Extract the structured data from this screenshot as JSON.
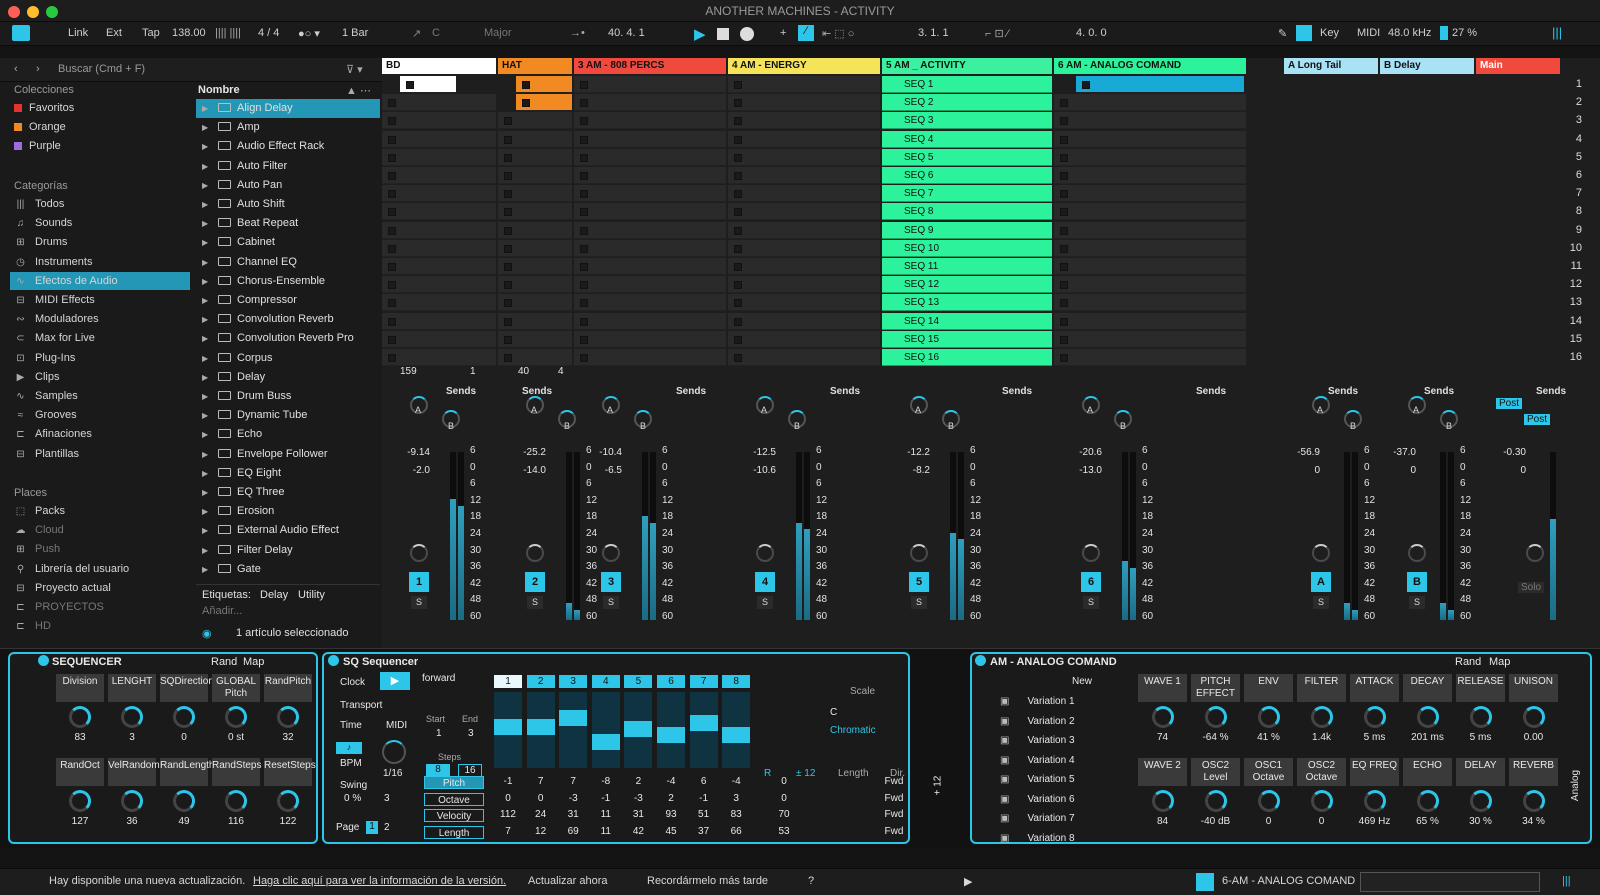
{
  "app": {
    "title": "ANOTHER MACHINES - ACTIVITY"
  },
  "control_bar": {
    "link": "Link",
    "ext": "Ext",
    "tap": "Tap",
    "tempo": "138.00",
    "signature": "4 / 4",
    "quantize": "1 Bar",
    "key": "C",
    "scale": "Major",
    "position": "40.  4.  1",
    "loop_start": "3.  1.  1",
    "loop_length": "4.  0.  0",
    "key_btn": "Key",
    "midi_btn": "MIDI",
    "sample_rate": "48.0 kHz",
    "cpu": "27 %"
  },
  "browser": {
    "search_placeholder": "Buscar (Cmd + F)",
    "col_header": "Nombre",
    "collections_title": "Colecciones",
    "collections": [
      {
        "label": "Favoritos",
        "color": "#e5332f"
      },
      {
        "label": "Orange",
        "color": "#f28a23"
      },
      {
        "label": "Purple",
        "color": "#9b6ddf"
      }
    ],
    "categories_title": "Categorías",
    "categories": [
      {
        "label": "Todos",
        "icon": "bars-icon"
      },
      {
        "label": "Sounds",
        "icon": "note-icon"
      },
      {
        "label": "Drums",
        "icon": "grid-icon"
      },
      {
        "label": "Instruments",
        "icon": "clock-icon"
      },
      {
        "label": "Efectos de Audio",
        "icon": "wave-icon"
      },
      {
        "label": "MIDI Effects",
        "icon": "midi-icon"
      },
      {
        "label": "Moduladores",
        "icon": "mod-icon"
      },
      {
        "label": "Max for Live",
        "icon": "max-icon"
      },
      {
        "label": "Plug-Ins",
        "icon": "plug-icon"
      },
      {
        "label": "Clips",
        "icon": "clip-icon"
      },
      {
        "label": "Samples",
        "icon": "wave-icon"
      },
      {
        "label": "Grooves",
        "icon": "groove-icon"
      },
      {
        "label": "Afinaciones",
        "icon": "tune-icon"
      },
      {
        "label": "Plantillas",
        "icon": "template-icon"
      }
    ],
    "places_title": "Places",
    "places": [
      {
        "label": "Packs",
        "icon": "pack-icon"
      },
      {
        "label": "Cloud",
        "icon": "cloud-icon"
      },
      {
        "label": "Push",
        "icon": "push-icon"
      },
      {
        "label": "Librería del usuario",
        "icon": "user-icon"
      },
      {
        "label": "Proyecto actual",
        "icon": "project-icon"
      },
      {
        "label": "PROYECTOS",
        "icon": "folder-icon"
      },
      {
        "label": "HD",
        "icon": "folder-icon"
      }
    ],
    "items": [
      "Align Delay",
      "Amp",
      "Audio Effect Rack",
      "Auto Filter",
      "Auto Pan",
      "Auto Shift",
      "Beat Repeat",
      "Cabinet",
      "Channel EQ",
      "Chorus-Ensemble",
      "Compressor",
      "Convolution Reverb",
      "Convolution Reverb Pro",
      "Corpus",
      "Delay",
      "Drum Buss",
      "Dynamic Tube",
      "Echo",
      "Envelope Follower",
      "EQ Eight",
      "EQ Three",
      "Erosion",
      "External Audio Effect",
      "Filter Delay",
      "Gate"
    ],
    "tags_label": "Etiquetas:",
    "tags": [
      "Delay",
      "Utility"
    ],
    "add_tag": "Añadir...",
    "selection_status": "1 artículo seleccionado"
  },
  "tracks": [
    {
      "name": "BD",
      "color": "#ffffff",
      "vol": "-9.14",
      "peak": "-2.0",
      "num": "1",
      "meter": 0.72
    },
    {
      "name": "HAT",
      "color": "#f28a23",
      "vol": "-25.2",
      "peak": "-14.0",
      "num": "2",
      "meter": 0.1
    },
    {
      "name": "3 AM - 808 PERCS",
      "color": "#f04a3e",
      "vol": "-10.4",
      "peak": "-6.5",
      "num": "3",
      "meter": 0.62
    },
    {
      "name": "4 AM - ENERGY",
      "color": "#f5e35a",
      "vol": "-12.5",
      "peak": "-10.6",
      "num": "4",
      "meter": 0.58
    },
    {
      "name": "5 AM _ ACTIVITY",
      "color": "#3cf0a0",
      "vol": "-12.2",
      "peak": "-8.2",
      "num": "5",
      "meter": 0.52
    },
    {
      "name": "6 AM - ANALOG COMAND",
      "color": "#2cf39b",
      "vol": "-20.6",
      "peak": "-13.0",
      "num": "6",
      "meter": 0.35
    }
  ],
  "returns": [
    {
      "name": "A Long Tail",
      "color": "#a9e2f4",
      "vol": "-56.9",
      "peak": "0",
      "num": "A"
    },
    {
      "name": "B Delay",
      "color": "#a9e2f4",
      "vol": "-37.0",
      "peak": "0",
      "num": "B"
    }
  ],
  "master": {
    "name": "Main",
    "color": "#f04a3e",
    "vol": "-0.30",
    "peak": "0",
    "post": "Post",
    "solo": "Solo"
  },
  "sends_label": "Sends",
  "send_a": "A",
  "send_b": "B",
  "solo_btn": "S",
  "scale_marks": [
    "6",
    "0",
    "6",
    "12",
    "18",
    "24",
    "30",
    "36",
    "42",
    "48",
    "60"
  ],
  "clip_slots": {
    "seq_clips": [
      "SEQ 1",
      "SEQ 2",
      "SEQ 3",
      "SEQ 4",
      "SEQ 5",
      "SEQ 6",
      "SEQ 7",
      "SEQ 8",
      "SEQ 9",
      "SEQ 10",
      "SEQ 11",
      "SEQ 12",
      "SEQ 13",
      "SEQ 14",
      "SEQ 15",
      "SEQ 16"
    ]
  },
  "scenes": [
    "1",
    "2",
    "3",
    "4",
    "5",
    "6",
    "7",
    "8",
    "9",
    "10",
    "11",
    "12",
    "13",
    "14",
    "15",
    "16"
  ],
  "track_info": {
    "bd_a": "159",
    "bd_b": "1",
    "hat_a": "40",
    "hat_b": "4"
  },
  "devices": {
    "sequencer": {
      "title": "SEQUENCER",
      "rand": "Rand",
      "map": "Map",
      "row1": [
        {
          "label": "Division",
          "value": "83"
        },
        {
          "label": "LENGHT",
          "value": "3"
        },
        {
          "label": "SQDirection",
          "value": "0"
        },
        {
          "label": "GLOBAL Pitch",
          "value": "0 st"
        },
        {
          "label": "RandPitch",
          "value": "32"
        }
      ],
      "row2": [
        {
          "label": "RandOct",
          "value": "127"
        },
        {
          "label": "VelRandom",
          "value": "36"
        },
        {
          "label": "RandLength",
          "value": "49"
        },
        {
          "label": "RandSteps",
          "value": "116"
        },
        {
          "label": "ResetSteps",
          "value": "122"
        }
      ]
    },
    "sq": {
      "title": "SQ Sequencer",
      "direction": "forward",
      "clock": "Clock",
      "transport": "Transport",
      "time": "Time",
      "midi": "MIDI",
      "bpm": "BPM",
      "rate": "1/16",
      "swing_label": "Swing",
      "swing": "0 %",
      "start_label": "Start",
      "end_label": "End",
      "start": "1",
      "end": "3",
      "steps_label": "Steps",
      "steps_a": "8",
      "steps_b": "16",
      "page_label": "Page",
      "page_a": "1",
      "page_b": "2",
      "num_3": "3",
      "step_numbers": [
        "1",
        "2",
        "3",
        "4",
        "5",
        "6",
        "7",
        "8"
      ],
      "rows": [
        {
          "label": "Pitch",
          "values": [
            "-1",
            "7",
            "7",
            "-8",
            "2",
            "-4",
            "6",
            "-4"
          ],
          "extra": "0"
        },
        {
          "label": "Octave",
          "values": [
            "0",
            "0",
            "-3",
            "-1",
            "-3",
            "2",
            "-1",
            "3"
          ],
          "extra": "0"
        },
        {
          "label": "Velocity",
          "values": [
            "112",
            "24",
            "31",
            "11",
            "31",
            "93",
            "51",
            "83"
          ],
          "extra": "70"
        },
        {
          "label": "Length",
          "values": [
            "7",
            "12",
            "69",
            "11",
            "42",
            "45",
            "37",
            "66"
          ],
          "extra": "53"
        }
      ],
      "scale_label": "Scale",
      "root": "C",
      "scale_type": "Chromatic",
      "range": "± 12",
      "length_label": "Length",
      "dir_label": "Dir.",
      "fwd": "Fwd",
      "r_label": "R",
      "plus12": "+ 12"
    },
    "analog": {
      "title": "AM - ANALOG COMAND",
      "rand": "Rand",
      "map": "Map",
      "new_btn": "New",
      "variations": [
        "Variation 1",
        "Variation 2",
        "Variation 3",
        "Variation 4",
        "Variation 5",
        "Variation 6",
        "Variation 7",
        "Variation 8"
      ],
      "row1": [
        {
          "label": "WAVE 1",
          "value": "74"
        },
        {
          "label": "PITCH EFFECT",
          "value": "-64 %"
        },
        {
          "label": "ENV",
          "value": "41 %"
        },
        {
          "label": "FILTER",
          "value": "1.4k"
        },
        {
          "label": "ATTACK",
          "value": "5 ms"
        },
        {
          "label": "DECAY",
          "value": "201 ms"
        },
        {
          "label": "RELEASE",
          "value": "5 ms"
        },
        {
          "label": "UNISON",
          "value": "0.00"
        }
      ],
      "row2": [
        {
          "label": "WAVE 2",
          "value": "84"
        },
        {
          "label": "OSC2 Level",
          "value": "-40 dB"
        },
        {
          "label": "OSC1 Octave",
          "value": "0"
        },
        {
          "label": "OSC2 Octave",
          "value": "0"
        },
        {
          "label": "EQ FREQ",
          "value": "469 Hz"
        },
        {
          "label": "ECHO",
          "value": "65 %"
        },
        {
          "label": "DELAY",
          "value": "30 %"
        },
        {
          "label": "REVERB",
          "value": "34 %"
        }
      ],
      "side_label": "Analog"
    }
  },
  "status": {
    "message": "Hay disponible una nueva actualización.",
    "link": "Haga clic aquí para ver la información de la versión.",
    "update_now": "Actualizar ahora",
    "remind_later": "Recordármelo más tarde",
    "help": "?",
    "selected_track": "6-AM - ANALOG COMAND"
  }
}
